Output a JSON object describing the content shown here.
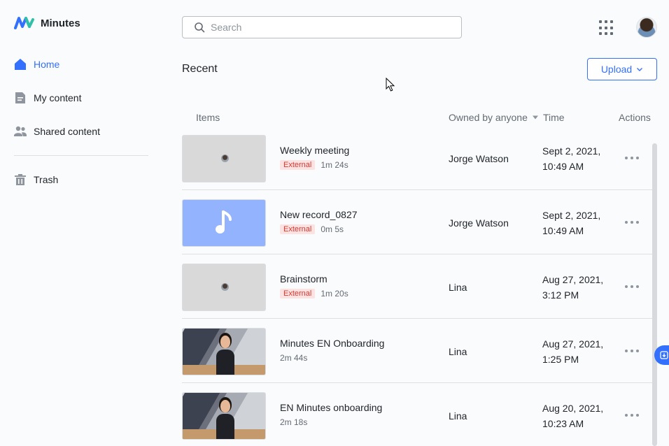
{
  "app": {
    "name": "Minutes"
  },
  "sidebar": {
    "items": [
      {
        "label": "Home",
        "icon": "home-icon",
        "active": true
      },
      {
        "label": "My content",
        "icon": "document-icon",
        "active": false
      },
      {
        "label": "Shared content",
        "icon": "users-icon",
        "active": false
      },
      {
        "label": "Trash",
        "icon": "trash-icon",
        "active": false
      }
    ]
  },
  "header": {
    "search_placeholder": "Search"
  },
  "main": {
    "title": "Recent",
    "upload_label": "Upload",
    "columns": {
      "items": "Items",
      "owner": "Owned by anyone",
      "time": "Time",
      "actions": "Actions"
    },
    "rows": [
      {
        "title": "Weekly meeting",
        "tag": "External",
        "duration": "1m 24s",
        "owner": "Jorge Watson",
        "time_line1": "Sept 2, 2021,",
        "time_line2": "10:49 AM",
        "thumb": "gray"
      },
      {
        "title": "New record_0827",
        "tag": "External",
        "duration": "0m 5s",
        "owner": "Jorge Watson",
        "time_line1": "Sept 2, 2021,",
        "time_line2": "10:49 AM",
        "thumb": "audio"
      },
      {
        "title": "Brainstorm",
        "tag": "External",
        "duration": "1m 20s",
        "owner": "Lina",
        "time_line1": "Aug 27, 2021,",
        "time_line2": "3:12 PM",
        "thumb": "gray"
      },
      {
        "title": "Minutes EN Onboarding",
        "tag": "",
        "duration": "2m 44s",
        "owner": "Lina",
        "time_line1": "Aug 27, 2021,",
        "time_line2": "1:25 PM",
        "thumb": "video"
      },
      {
        "title": "EN Minutes onboarding",
        "tag": "",
        "duration": "2m 18s",
        "owner": "Lina",
        "time_line1": "Aug 20, 2021,",
        "time_line2": "10:23 AM",
        "thumb": "video"
      }
    ]
  },
  "colors": {
    "accent": "#3370ff",
    "tag_bg": "#fde2e2",
    "tag_text": "#d83931",
    "audio_thumb": "#94b3ff"
  }
}
